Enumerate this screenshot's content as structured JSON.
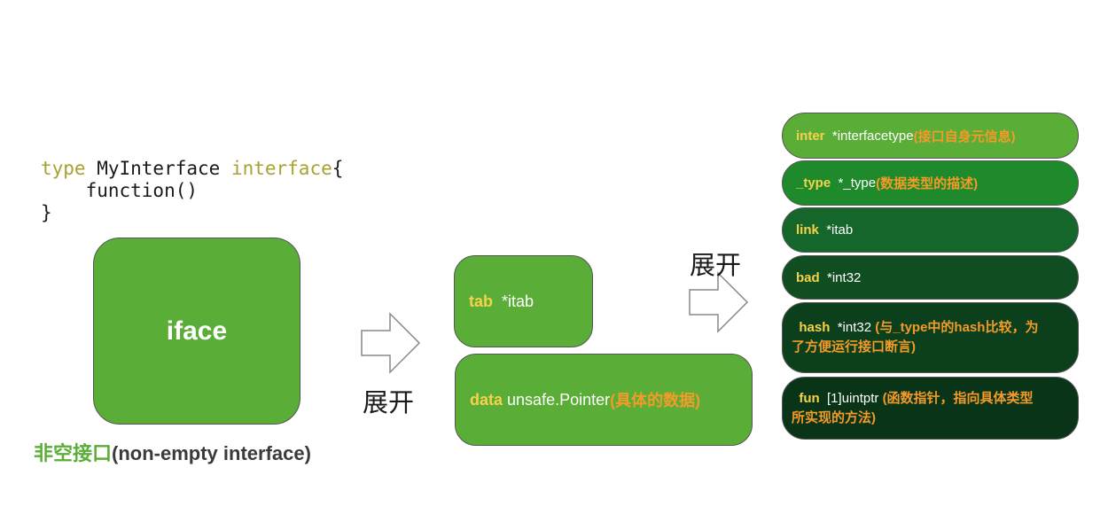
{
  "code": {
    "line1_kw1": "type",
    "line1_name": " MyInterface ",
    "line1_kw2": "interface",
    "line1_end": "{",
    "line2": "    function()",
    "line3": "}"
  },
  "iface": {
    "label": "iface",
    "caption_cn": "非空接口",
    "caption_en": "(non-empty interface)"
  },
  "expand_label": "展开",
  "tab_field": {
    "name": "tab",
    "type": "*itab"
  },
  "data_field": {
    "name": "data",
    "type": "unsafe.Pointer ",
    "note": "(具体的数据)"
  },
  "itab_fields": [
    {
      "name": "inter",
      "type": "*interfacetype ",
      "note": "(接口自身元信息)",
      "color": "#5aae37"
    },
    {
      "name": "_type",
      "type": "*_type ",
      "note": "(数据类型的描述)",
      "color": "#1f8a2c"
    },
    {
      "name": "link",
      "type": "*itab",
      "note": "",
      "color": "#14662a"
    },
    {
      "name": "bad",
      "type": "*int32",
      "note": "",
      "color": "#104e22"
    },
    {
      "name": "hash",
      "type": "*int32 ",
      "note": "(与_type中的hash比较，为",
      "note2": "了方便运行接口断言)",
      "color": "#0c401d"
    },
    {
      "name": "fun",
      "type": "[1]uintptr ",
      "note": "(函数指针，指向具体类型",
      "note2": "所实现的方法)",
      "color": "#0a3418"
    }
  ],
  "colors": {
    "green": "#5aae37",
    "field_name": "#f6d24a",
    "note": "#f39a28"
  }
}
